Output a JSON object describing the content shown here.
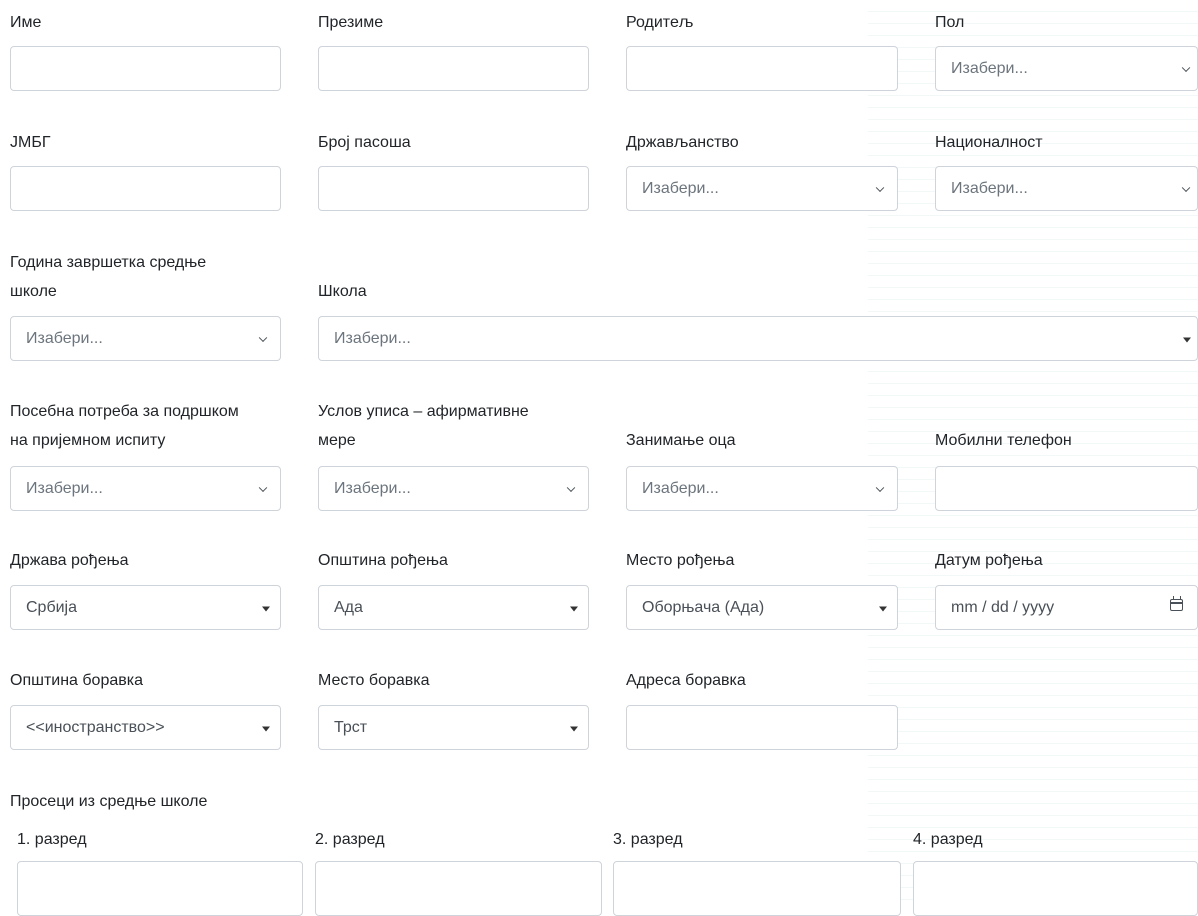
{
  "fields": {
    "ime": {
      "label": "Име",
      "value": ""
    },
    "prezime": {
      "label": "Презиме",
      "value": ""
    },
    "roditelj": {
      "label": "Родитељ",
      "value": ""
    },
    "pol": {
      "label": "Пол",
      "placeholder": "Изабери..."
    },
    "jmbg": {
      "label": "ЈМБГ",
      "value": ""
    },
    "broj_pasosa": {
      "label": "Број пасоша",
      "value": ""
    },
    "drzavljanstvo": {
      "label": "Држављанство",
      "placeholder": "Изабери..."
    },
    "nacionalnost": {
      "label": "Националност",
      "placeholder": "Изабери..."
    },
    "godina_zavrsetka": {
      "label_line1": "Година завршетка средње",
      "label_line2": "школе",
      "placeholder": "Изабери..."
    },
    "skola": {
      "label": "Школа",
      "placeholder": "Изабери..."
    },
    "posebna_potreba": {
      "label_line1": "Посебна потреба за подршком",
      "label_line2": "на пријемном испиту",
      "placeholder": "Изабери..."
    },
    "uslov_upisa": {
      "label_line1": "Услов уписа – афирмативне",
      "label_line2": "мере",
      "placeholder": "Изабери..."
    },
    "zanimanje_oca": {
      "label": "Занимање оца",
      "placeholder": "Изабери..."
    },
    "mobilni": {
      "label": "Мобилни телефон",
      "value": ""
    },
    "drzava_rodjenja": {
      "label": "Држава рођења",
      "value": "Србија"
    },
    "opstina_rodjenja": {
      "label": "Општина рођења",
      "value": "Ада"
    },
    "mesto_rodjenja": {
      "label": "Место рођења",
      "value": "Оборњача (Ада)"
    },
    "datum_rodjenja": {
      "label": "Датум рођења",
      "placeholder": "mm / dd / yyyy"
    },
    "opstina_boravka": {
      "label": "Општина боравка",
      "value": "<<иностранство>>"
    },
    "mesto_boravka": {
      "label": "Место боравка",
      "value": "Трст"
    },
    "adresa_boravka": {
      "label": "Адреса боравка",
      "value": ""
    }
  },
  "averages": {
    "title": "Просеци из средње школе",
    "grades": [
      "1. разред",
      "2. разред",
      "3. разред",
      "4. разред"
    ]
  }
}
